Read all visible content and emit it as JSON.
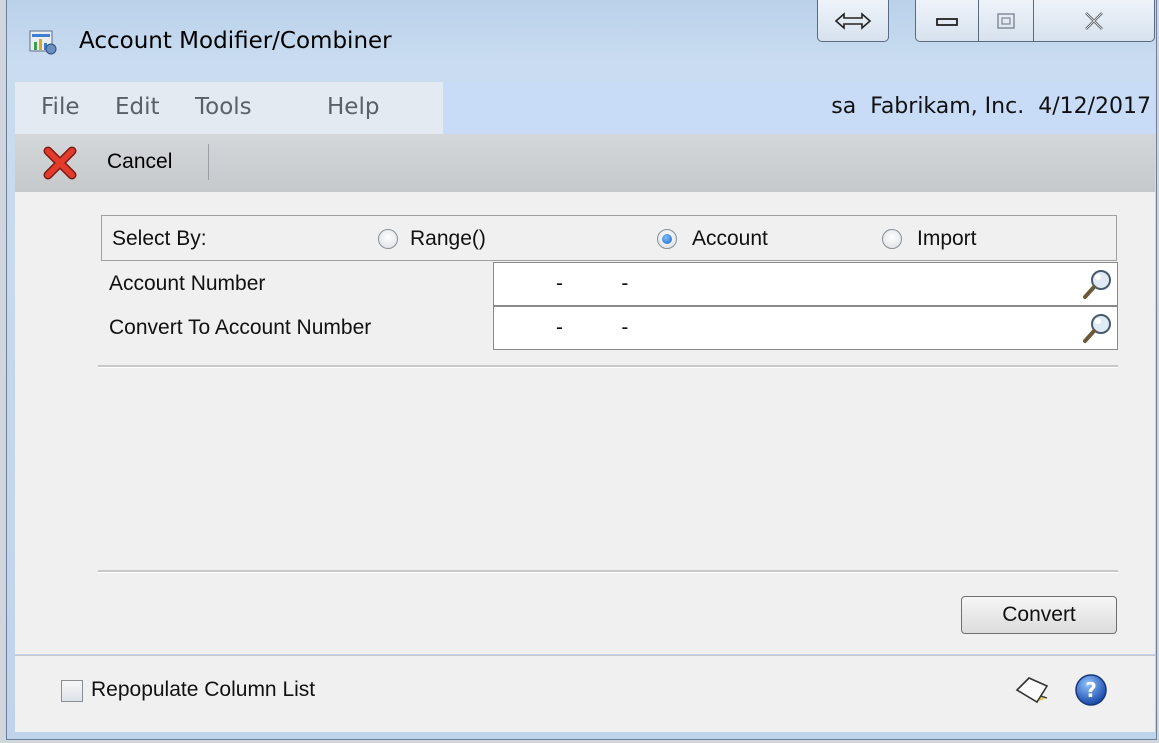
{
  "window": {
    "title": "Account Modifier/Combiner"
  },
  "menu": {
    "items": [
      "File",
      "Edit",
      "Tools",
      "Help"
    ],
    "status": "sa  Fabrikam, Inc.  4/12/2017"
  },
  "toolbar": {
    "cancel_label": "Cancel"
  },
  "form": {
    "select_by_label": "Select By:",
    "options": [
      {
        "label": "Range()",
        "checked": false
      },
      {
        "label": "Account",
        "checked": true
      },
      {
        "label": "Import",
        "checked": false
      }
    ],
    "account_number_label": "Account Number",
    "account_number_value": "-          -",
    "convert_to_label": "Convert To Account Number",
    "convert_to_value": "-          -",
    "convert_button": "Convert"
  },
  "footer": {
    "repopulate_label": "Repopulate Column List",
    "repopulate_checked": false
  },
  "colors": {
    "title_bar": "#c9dcf0",
    "menu_highlight": "#c9dcf7",
    "body_bg": "#f0f0f0",
    "cancel_red": "#d22a1e",
    "help_blue": "#1f5fc8"
  }
}
